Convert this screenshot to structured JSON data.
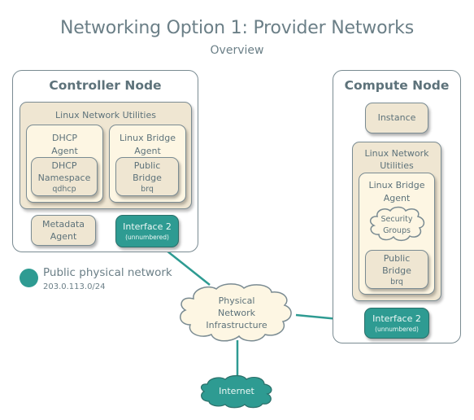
{
  "title": "Networking Option 1: Provider Networks",
  "subtitle": "Overview",
  "colors": {
    "teal": "#2e9b92",
    "cream": "#fdf6e3",
    "beige": "#efe6d2",
    "border": "#7a8b92",
    "text": "#5d727a"
  },
  "controller": {
    "title": "Controller Node",
    "utilities": "Linux Network Utilities",
    "dhcp_agent": {
      "line1": "DHCP",
      "line2": "Agent"
    },
    "dhcp_namespace": {
      "line1": "DHCP",
      "line2": "Namespace",
      "line3": "qdhcp"
    },
    "bridge_agent": {
      "line1": "Linux Bridge",
      "line2": "Agent"
    },
    "public_bridge": {
      "line1": "Public",
      "line2": "Bridge",
      "line3": "brq"
    },
    "metadata_agent": {
      "line1": "Metadata",
      "line2": "Agent"
    },
    "interface": {
      "line1": "Interface 2",
      "line2": "(unnumbered)"
    }
  },
  "compute": {
    "title": "Compute Node",
    "instance": "Instance",
    "utilities": {
      "line1": "Linux Network",
      "line2": "Utilities"
    },
    "bridge_agent": {
      "line1": "Linux Bridge",
      "line2": "Agent"
    },
    "security_groups": {
      "line1": "Security",
      "line2": "Groups"
    },
    "public_bridge": {
      "line1": "Public",
      "line2": "Bridge",
      "line3": "brq"
    },
    "interface": {
      "line1": "Interface 2",
      "line2": "(unnumbered)"
    }
  },
  "legend": {
    "label": "Public physical network",
    "subnet": "203.0.113.0/24"
  },
  "physical_network": {
    "line1": "Physical",
    "line2": "Network",
    "line3": "Infrastructure"
  },
  "internet": "Internet"
}
